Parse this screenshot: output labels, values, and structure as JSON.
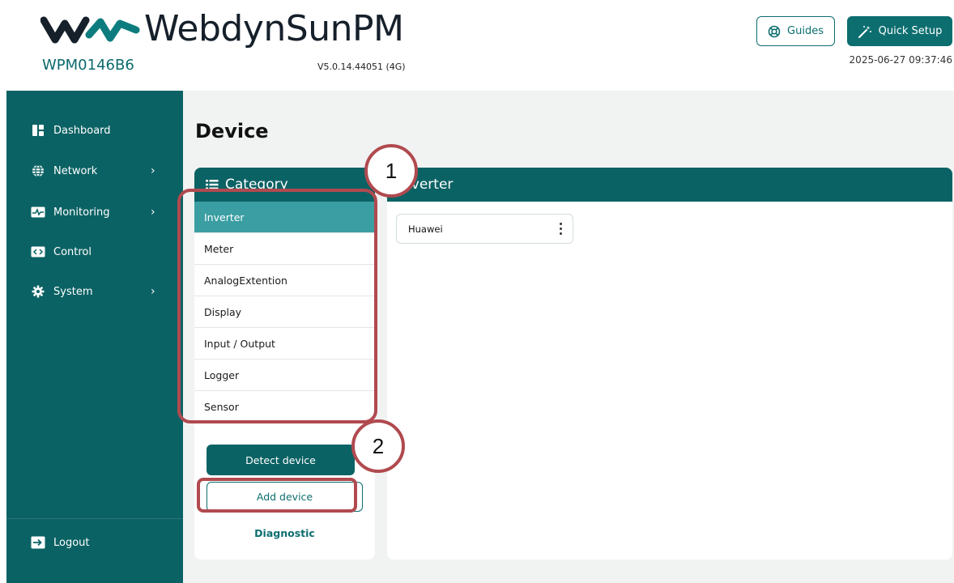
{
  "header": {
    "brand": "WebdynSunPM",
    "serial": "WPM0146B6",
    "version": "V5.0.14.44051 (4G)",
    "guides_label": "Guides",
    "quick_setup_label": "Quick Setup",
    "datetime": "2025-06-27 09:37:46",
    "brand_color": "#0d6e70"
  },
  "sidebar": {
    "items": [
      {
        "label": "Dashboard",
        "icon": "dashboard-icon"
      },
      {
        "label": "Network",
        "icon": "globe-icon",
        "has_submenu": true
      },
      {
        "label": "Monitoring",
        "icon": "monitoring-icon",
        "has_submenu": true
      },
      {
        "label": "Control",
        "icon": "code-icon"
      },
      {
        "label": "System",
        "icon": "gear-icon",
        "has_submenu": true
      }
    ],
    "logout_label": "Logout"
  },
  "main": {
    "title": "Device",
    "category_panel": {
      "title": "Category",
      "items": [
        "Inverter",
        "Meter",
        "AnalogExtention",
        "Display",
        "Input / Output",
        "Logger",
        "Sensor"
      ],
      "active": "Inverter",
      "detect_label": "Detect device",
      "add_label": "Add device",
      "diagnostic_label": "Diagnostic"
    },
    "device_panel": {
      "title": "Inverter",
      "devices": [
        "Huawei"
      ]
    }
  },
  "annotations": {
    "marker_1": "1",
    "marker_2": "2",
    "color": "#b04a4f"
  }
}
